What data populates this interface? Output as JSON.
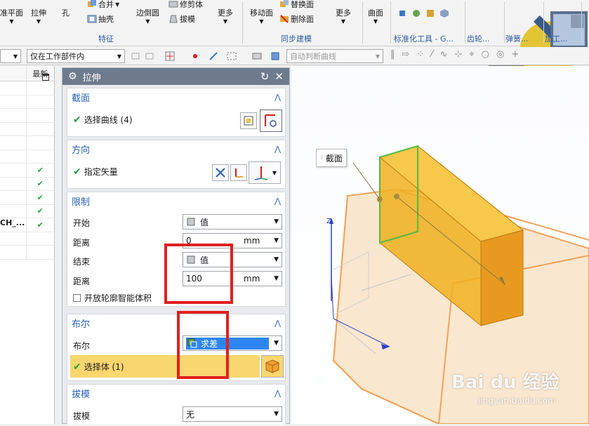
{
  "ribbon": {
    "datum_plane_label": "准平面",
    "extrude_label": "拉伸",
    "hole_label": "孔",
    "unite_label": "合并",
    "shell_label": "抽壳",
    "edge_blend_label": "边倒圆",
    "trim_body_label": "修剪体",
    "draft_label": "拔模",
    "more1_label": "更多",
    "feature_group": "特征",
    "move_face_label": "移动面",
    "replace_face_label": "替换面",
    "delete_face_label": "删除面",
    "more2_label": "更多",
    "sync_group": "同步建模",
    "surface_label": "曲面",
    "std_tools_group": "标准化工具 - G...",
    "gear_group": "齿轮...",
    "spring_group": "弹簧...",
    "machining_group": "加工..."
  },
  "filterbar": {
    "filter_value": "仅在工作部件内",
    "curve_rule_value": "自动判断曲线"
  },
  "navigator": {
    "col_latest": "最新",
    "rows": [
      {
        "name": "",
        "latest": false
      },
      {
        "name": "",
        "latest": false
      },
      {
        "name": "",
        "latest": false
      },
      {
        "name": "",
        "latest": false
      },
      {
        "name": "",
        "latest": false
      },
      {
        "name": "",
        "latest": false
      },
      {
        "name": "",
        "latest": true
      },
      {
        "name": "",
        "latest": true
      },
      {
        "name": "",
        "latest": true
      },
      {
        "name": "",
        "latest": true
      },
      {
        "name": "CH_...",
        "latest": true
      },
      {
        "name": "",
        "latest": false
      },
      {
        "name": "",
        "latest": false
      }
    ]
  },
  "dialog": {
    "title": "拉伸",
    "section": {
      "header": "截面",
      "select_curve": "选择曲线 (4)"
    },
    "direction": {
      "header": "方向",
      "specify_vector": "指定矢量"
    },
    "limits": {
      "header": "限制",
      "start_label": "开始",
      "start_value": "值",
      "start_distance_label": "距离",
      "start_distance": "0",
      "unit1": "mm",
      "end_label": "结束",
      "end_value": "值",
      "end_distance_label": "距离",
      "end_distance": "100",
      "unit2": "mm",
      "open_profile_label": "开放轮廓智能体积"
    },
    "boolean": {
      "header": "布尔",
      "boolean_label": "布尔",
      "boolean_value": "求差",
      "select_body": "选择体 (1)"
    },
    "draft": {
      "header": "拔模",
      "draft_label": "拔模",
      "draft_value": "无"
    }
  },
  "graphics": {
    "callout_label": "截面",
    "axis_z": "Z",
    "watermark_brand": "Bai du 经验",
    "watermark_url": "jingyan.baidu.com"
  },
  "colors": {
    "accent_blue": "#2b63b4",
    "check_green": "#22a33a",
    "highlight_yellow": "#f9d66e",
    "selected_blue": "#2d86f0",
    "annotation_red": "#e02020",
    "body_orange": "#f0a030"
  }
}
